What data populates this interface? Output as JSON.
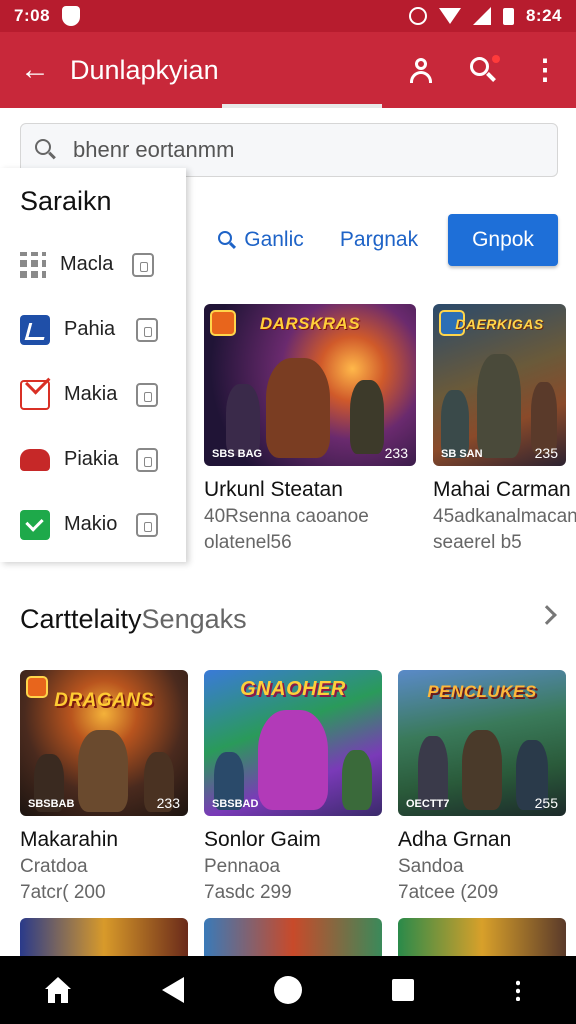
{
  "status_bar": {
    "time_left": "7:08",
    "time_right": "8:24"
  },
  "app_bar": {
    "title": "Dunlapkyian"
  },
  "search": {
    "value": "bhenr eortanmm",
    "placeholder": "bhenr eortanmm"
  },
  "drawer": {
    "heading": "Saraikn",
    "items": [
      {
        "label": "Macla",
        "icon": "grid-apps-icon"
      },
      {
        "label": "Pahia",
        "icon": "blue-app-icon"
      },
      {
        "label": "Makia",
        "icon": "mail-icon"
      },
      {
        "label": "Piakia",
        "icon": "car-icon"
      },
      {
        "label": "Makio",
        "icon": "green-app-icon"
      }
    ]
  },
  "chips": {
    "search": "Ganlic",
    "plain": "Pargnak",
    "primary": "Gnpok"
  },
  "featured": [
    {
      "name": "Urkunl Steatan",
      "sub": "40Rsenna caoanoe",
      "sub2": "olatenel56",
      "logo": "DARSKRAS",
      "badge": "SBS BAG",
      "score": "233"
    },
    {
      "name": "Mahai Carman",
      "sub": "45adkanalmacan",
      "sub2": "seaerel b5",
      "logo": "DAERKIGAS",
      "badge": "SB SAN",
      "score": "235"
    }
  ],
  "section": {
    "title_bold": "Carttelaity",
    "title_light": "Sengaks"
  },
  "grid": [
    {
      "name": "Makarahin",
      "sub": "Cratdoa",
      "sub2": "7atcr( 200",
      "logo": "DRAGANS",
      "badge": "SBSBAB",
      "score": "233"
    },
    {
      "name": "Sonlor Gaim",
      "sub": "Pennaoa",
      "sub2": "7asdc 299",
      "logo": "GNAOHER",
      "badge": "SBSBAD",
      "score": ""
    },
    {
      "name": "Adha Grnan",
      "sub": "Sandoa",
      "sub2": "7atcee (209",
      "logo": "PENCLUKES",
      "badge": "OECTT7",
      "score": "255"
    }
  ],
  "colors": {
    "status_bar": "#b71c2e",
    "app_bar": "#c8283a",
    "primary_blue": "#1e6fd8"
  }
}
